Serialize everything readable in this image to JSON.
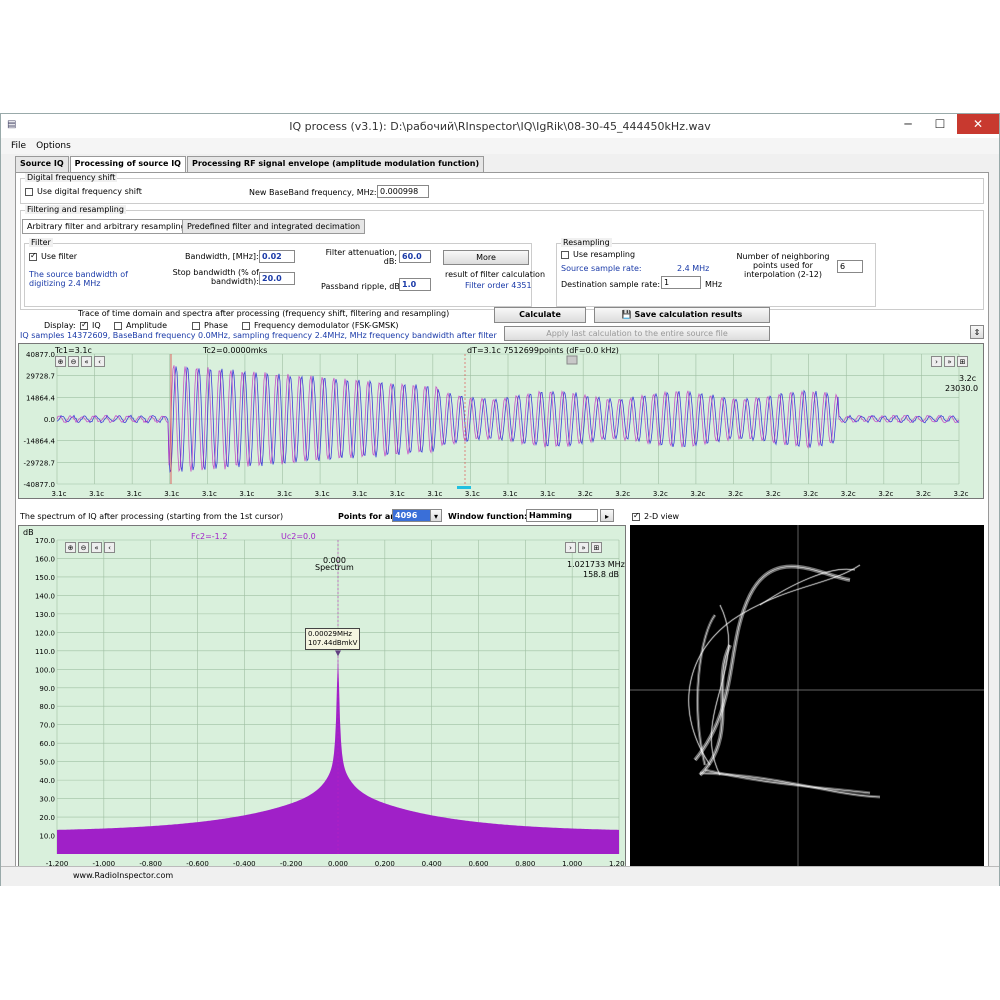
{
  "window": {
    "title": "IQ process (v3.1): D:\\рабочий\\RInspector\\IQ\\IgRik\\08-30-45_444450kHz.wav",
    "min": "─",
    "max": "☐",
    "close": "✕"
  },
  "menu": [
    "File",
    "Options"
  ],
  "tabs": [
    "Source IQ",
    "Processing of source IQ",
    "Processing RF signal envelope (amplitude modulation function)"
  ],
  "shift": {
    "group": "Digital frequency shift",
    "use_label": "Use digital frequency shift",
    "new_bb_label": "New BaseBand frequency, MHz:",
    "new_bb_value": "0.000998"
  },
  "filtering": {
    "group": "Filtering and resampling",
    "subtab1": "Arbitrary filter and arbitrary resampling",
    "subtab2": "Predefined filter and integrated decimation"
  },
  "filter": {
    "group": "Filter",
    "use_label": "Use filter",
    "source_bw": "The source bandwidth of digitizing 2.4 MHz",
    "bandwidth_label": "Bandwidth, [MHz]:",
    "bandwidth_value": "0.02",
    "stop_label": "Stop bandwidth (% of bandwidth):",
    "stop_value": "20.0",
    "atten_label": "Filter attenuation, dB:",
    "atten_value": "60.0",
    "ripple_label": "Passband ripple, dB:",
    "ripple_value": "1.0",
    "more_btn": "More",
    "result_label": "result of filter calculation",
    "order_label": "Filter order 4351"
  },
  "resampling": {
    "group": "Resampling",
    "use_label": "Use resampling",
    "src_rate_label": "Source sample rate:",
    "src_rate_value": "2.4 MHz",
    "dst_rate_label": "Destination sample rate:",
    "dst_rate_value": "1",
    "dst_unit": "MHz",
    "neighbors_label": "Number of neighboring points used for interpolation (2-12)",
    "neighbors_value": "6"
  },
  "trace": {
    "title": "Trace of time domain and spectra after processing  (frequency shift, filtering and resampling)",
    "display_label": "Display:",
    "opts": [
      "IQ",
      "Amplitude",
      "Phase",
      "Frequency demodulator (FSK-GMSK)"
    ],
    "calc_btn": "Calculate",
    "save_btn": "Save calculation results",
    "apply_btn": "Apply last calculation to the entire source file",
    "info": "IQ samples 14372609,  BaseBand frequency 0.0MHz, sampling frequency 2.4MHz, MHz frequency bandwidth after filter 0.0"
  },
  "time_plot": {
    "cursor1": "Tc1=3.1c",
    "cursor2": "Tc2=0.0000mks",
    "dt": "dT=3.1c 7512699points (dF=0.0 kHz)",
    "right_top": "3.2c",
    "right_val": "23030.0",
    "y_labels": [
      "40877.0",
      "29728.7",
      "14864.4",
      "0.0",
      "-14864.4",
      "-29728.7",
      "-40877.0"
    ],
    "x_labels": [
      "3.1c",
      "3.1c",
      "3.1c",
      "3.1c",
      "3.1c",
      "3.1c",
      "3.1c",
      "3.1c",
      "3.1c",
      "3.1c",
      "3.1c",
      "3.1c",
      "3.1c",
      "3.1c",
      "3.2c",
      "3.2c",
      "3.2c",
      "3.2c",
      "3.2c",
      "3.2c",
      "3.2c",
      "3.2c",
      "3.2c",
      "3.2c",
      "3.2c"
    ]
  },
  "spectrum": {
    "title": "The spectrum of IQ after processing (starting from the 1st cursor)",
    "points_label": "Points for analysis:",
    "points_value": "4096",
    "window_label": "Window function:",
    "window_value": "Hamming",
    "view2d": "2-D view",
    "fc2": "Fc2=-1.2",
    "uc2": "Uc2=0.0",
    "peak_top": "0.000",
    "peak_sub": "Spectrum",
    "right_freq": "1.021733 MHz",
    "right_db": "158.8 dB",
    "marker_freq": "0.00029MHz",
    "marker_db": "107.44dBmkV",
    "y_unit": "dB",
    "y_labels": [
      "170.0",
      "160.0",
      "150.0",
      "140.0",
      "130.0",
      "120.0",
      "110.0",
      "100.0",
      "90.0",
      "80.0",
      "70.0",
      "60.0",
      "50.0",
      "40.0",
      "30.0",
      "20.0",
      "10.0"
    ],
    "x_labels": [
      "-1.200",
      "-1.000",
      "-0.800",
      "-0.600",
      "-0.400",
      "-0.200",
      "0.000",
      "0.200",
      "0.400",
      "0.600",
      "0.800",
      "1.000",
      "1.200"
    ]
  },
  "status": {
    "url": "www.RadioInspector.com"
  },
  "colors": {
    "plot_bg": "#d9f0dc",
    "i_trace": "#2a2ad8",
    "q_trace": "#c020c0",
    "spectrum": "#a020c8",
    "vector_bg": "#000000"
  }
}
